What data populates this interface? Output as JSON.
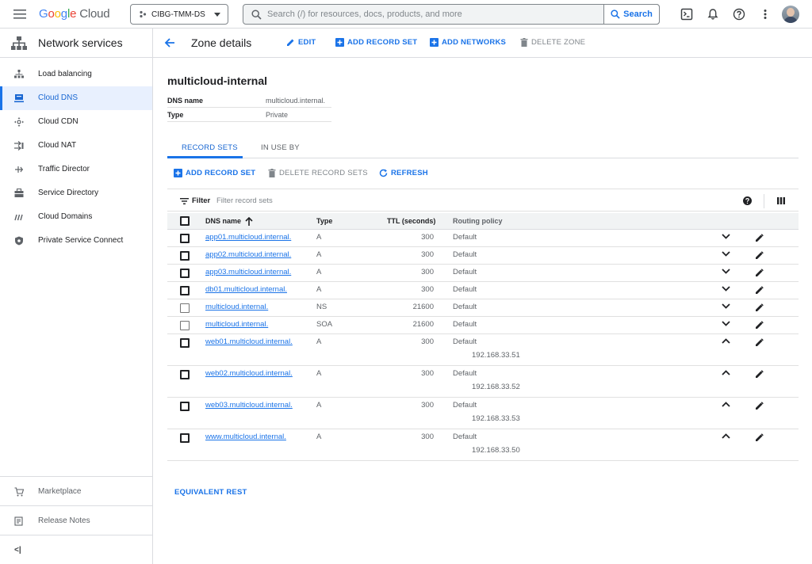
{
  "topbar": {
    "logo": {
      "g": "G",
      "o1": "o",
      "o2": "o",
      "g2": "g",
      "l": "l",
      "e": "e",
      "cloud": "Cloud"
    },
    "project": "CIBG-TMM-DS",
    "search_placeholder": "Search (/) for resources, docs, products, and more",
    "search_button": "Search"
  },
  "sidebar": {
    "title": "Network services",
    "items": [
      {
        "label": "Load balancing",
        "icon": "load-balancing-icon"
      },
      {
        "label": "Cloud DNS",
        "icon": "cloud-dns-icon",
        "active": true
      },
      {
        "label": "Cloud CDN",
        "icon": "cloud-cdn-icon"
      },
      {
        "label": "Cloud NAT",
        "icon": "cloud-nat-icon"
      },
      {
        "label": "Traffic Director",
        "icon": "traffic-director-icon"
      },
      {
        "label": "Service Directory",
        "icon": "service-directory-icon"
      },
      {
        "label": "Cloud Domains",
        "icon": "cloud-domains-icon"
      },
      {
        "label": "Private Service Connect",
        "icon": "private-service-connect-icon"
      }
    ],
    "marketplace": "Marketplace",
    "release_notes": "Release Notes",
    "collapse": "<|"
  },
  "actionbar": {
    "title": "Zone details",
    "edit": "EDIT",
    "add_record_set": "ADD RECORD SET",
    "add_networks": "ADD NETWORKS",
    "delete_zone": "DELETE ZONE"
  },
  "zone": {
    "name": "multicloud-internal",
    "dns_name_label": "DNS name",
    "dns_name": "multicloud.internal.",
    "type_label": "Type",
    "type": "Private"
  },
  "tabs": {
    "record_sets": "RECORD SETS",
    "in_use_by": "IN USE BY"
  },
  "record_actions": {
    "add": "ADD RECORD SET",
    "delete": "DELETE RECORD SETS",
    "refresh": "REFRESH"
  },
  "filter": {
    "label": "Filter",
    "placeholder": "Filter record sets"
  },
  "table": {
    "columns": {
      "dns_name": "DNS name",
      "type": "Type",
      "ttl": "TTL (seconds)",
      "policy": "Routing policy"
    },
    "rows": [
      {
        "name": "app01.multicloud.internal.",
        "type": "A",
        "ttl": "300",
        "policy": "Default",
        "expanded": false
      },
      {
        "name": "app02.multicloud.internal.",
        "type": "A",
        "ttl": "300",
        "policy": "Default",
        "expanded": false
      },
      {
        "name": "app03.multicloud.internal.",
        "type": "A",
        "ttl": "300",
        "policy": "Default",
        "expanded": false
      },
      {
        "name": "db01.multicloud.internal.",
        "type": "A",
        "ttl": "300",
        "policy": "Default",
        "expanded": false
      },
      {
        "name": "multicloud.internal.",
        "type": "NS",
        "ttl": "21600",
        "policy": "Default",
        "expanded": false,
        "light": true
      },
      {
        "name": "multicloud.internal.",
        "type": "SOA",
        "ttl": "21600",
        "policy": "Default",
        "expanded": false,
        "light": true
      },
      {
        "name": "web01.multicloud.internal.",
        "type": "A",
        "ttl": "300",
        "policy": "Default",
        "expanded": true,
        "ip": "192.168.33.51"
      },
      {
        "name": "web02.multicloud.internal.",
        "type": "A",
        "ttl": "300",
        "policy": "Default",
        "expanded": true,
        "ip": "192.168.33.52"
      },
      {
        "name": "web03.multicloud.internal.",
        "type": "A",
        "ttl": "300",
        "policy": "Default",
        "expanded": true,
        "ip": "192.168.33.53"
      },
      {
        "name": "www.multicloud.internal.",
        "type": "A",
        "ttl": "300",
        "policy": "Default",
        "expanded": true,
        "ip": "192.168.33.50"
      }
    ]
  },
  "equivalent_rest": "EQUIVALENT REST",
  "colors": {
    "accent": "#1a73e8",
    "active_bg": "#e8f0fe",
    "border": "#dadce0"
  }
}
